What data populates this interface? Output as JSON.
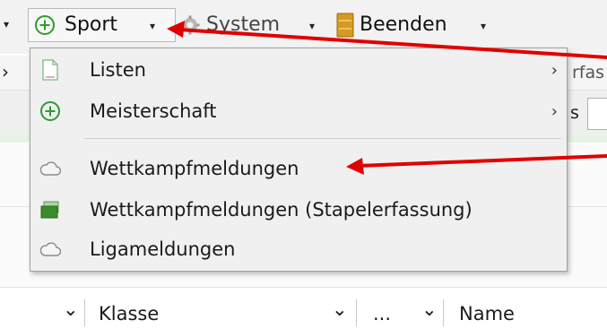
{
  "toolbar": {
    "left_caret": "▾",
    "sport_label": "Sport",
    "system_label": "System",
    "exit_label": "Beenden",
    "caret": "▾",
    "colors": {
      "sport_icon": "#2e9b2e",
      "exit_icon": "#d79a21"
    }
  },
  "background": {
    "side_partial_text": "rfas",
    "row_left_arrow": "›",
    "row2_partial": "s"
  },
  "menu": {
    "items": [
      {
        "label": "Listen",
        "icon": "document-icon",
        "submenu": "›"
      },
      {
        "label": "Meisterschaft",
        "icon": "plus-circle-icon",
        "submenu": "›"
      },
      {
        "label": "Wettkampfmeldungen",
        "icon": "cloud-icon"
      },
      {
        "label": "Wettkampfmeldungen (Stapelerfassung)",
        "icon": "stack-icon"
      },
      {
        "label": "Ligameldungen",
        "icon": "cloud-icon"
      }
    ]
  },
  "table_header": {
    "caret": "⌄",
    "klasse": "Klasse",
    "ellipsis": "...",
    "name": "Name"
  },
  "annotations": {
    "arrow_color": "#e00000"
  }
}
